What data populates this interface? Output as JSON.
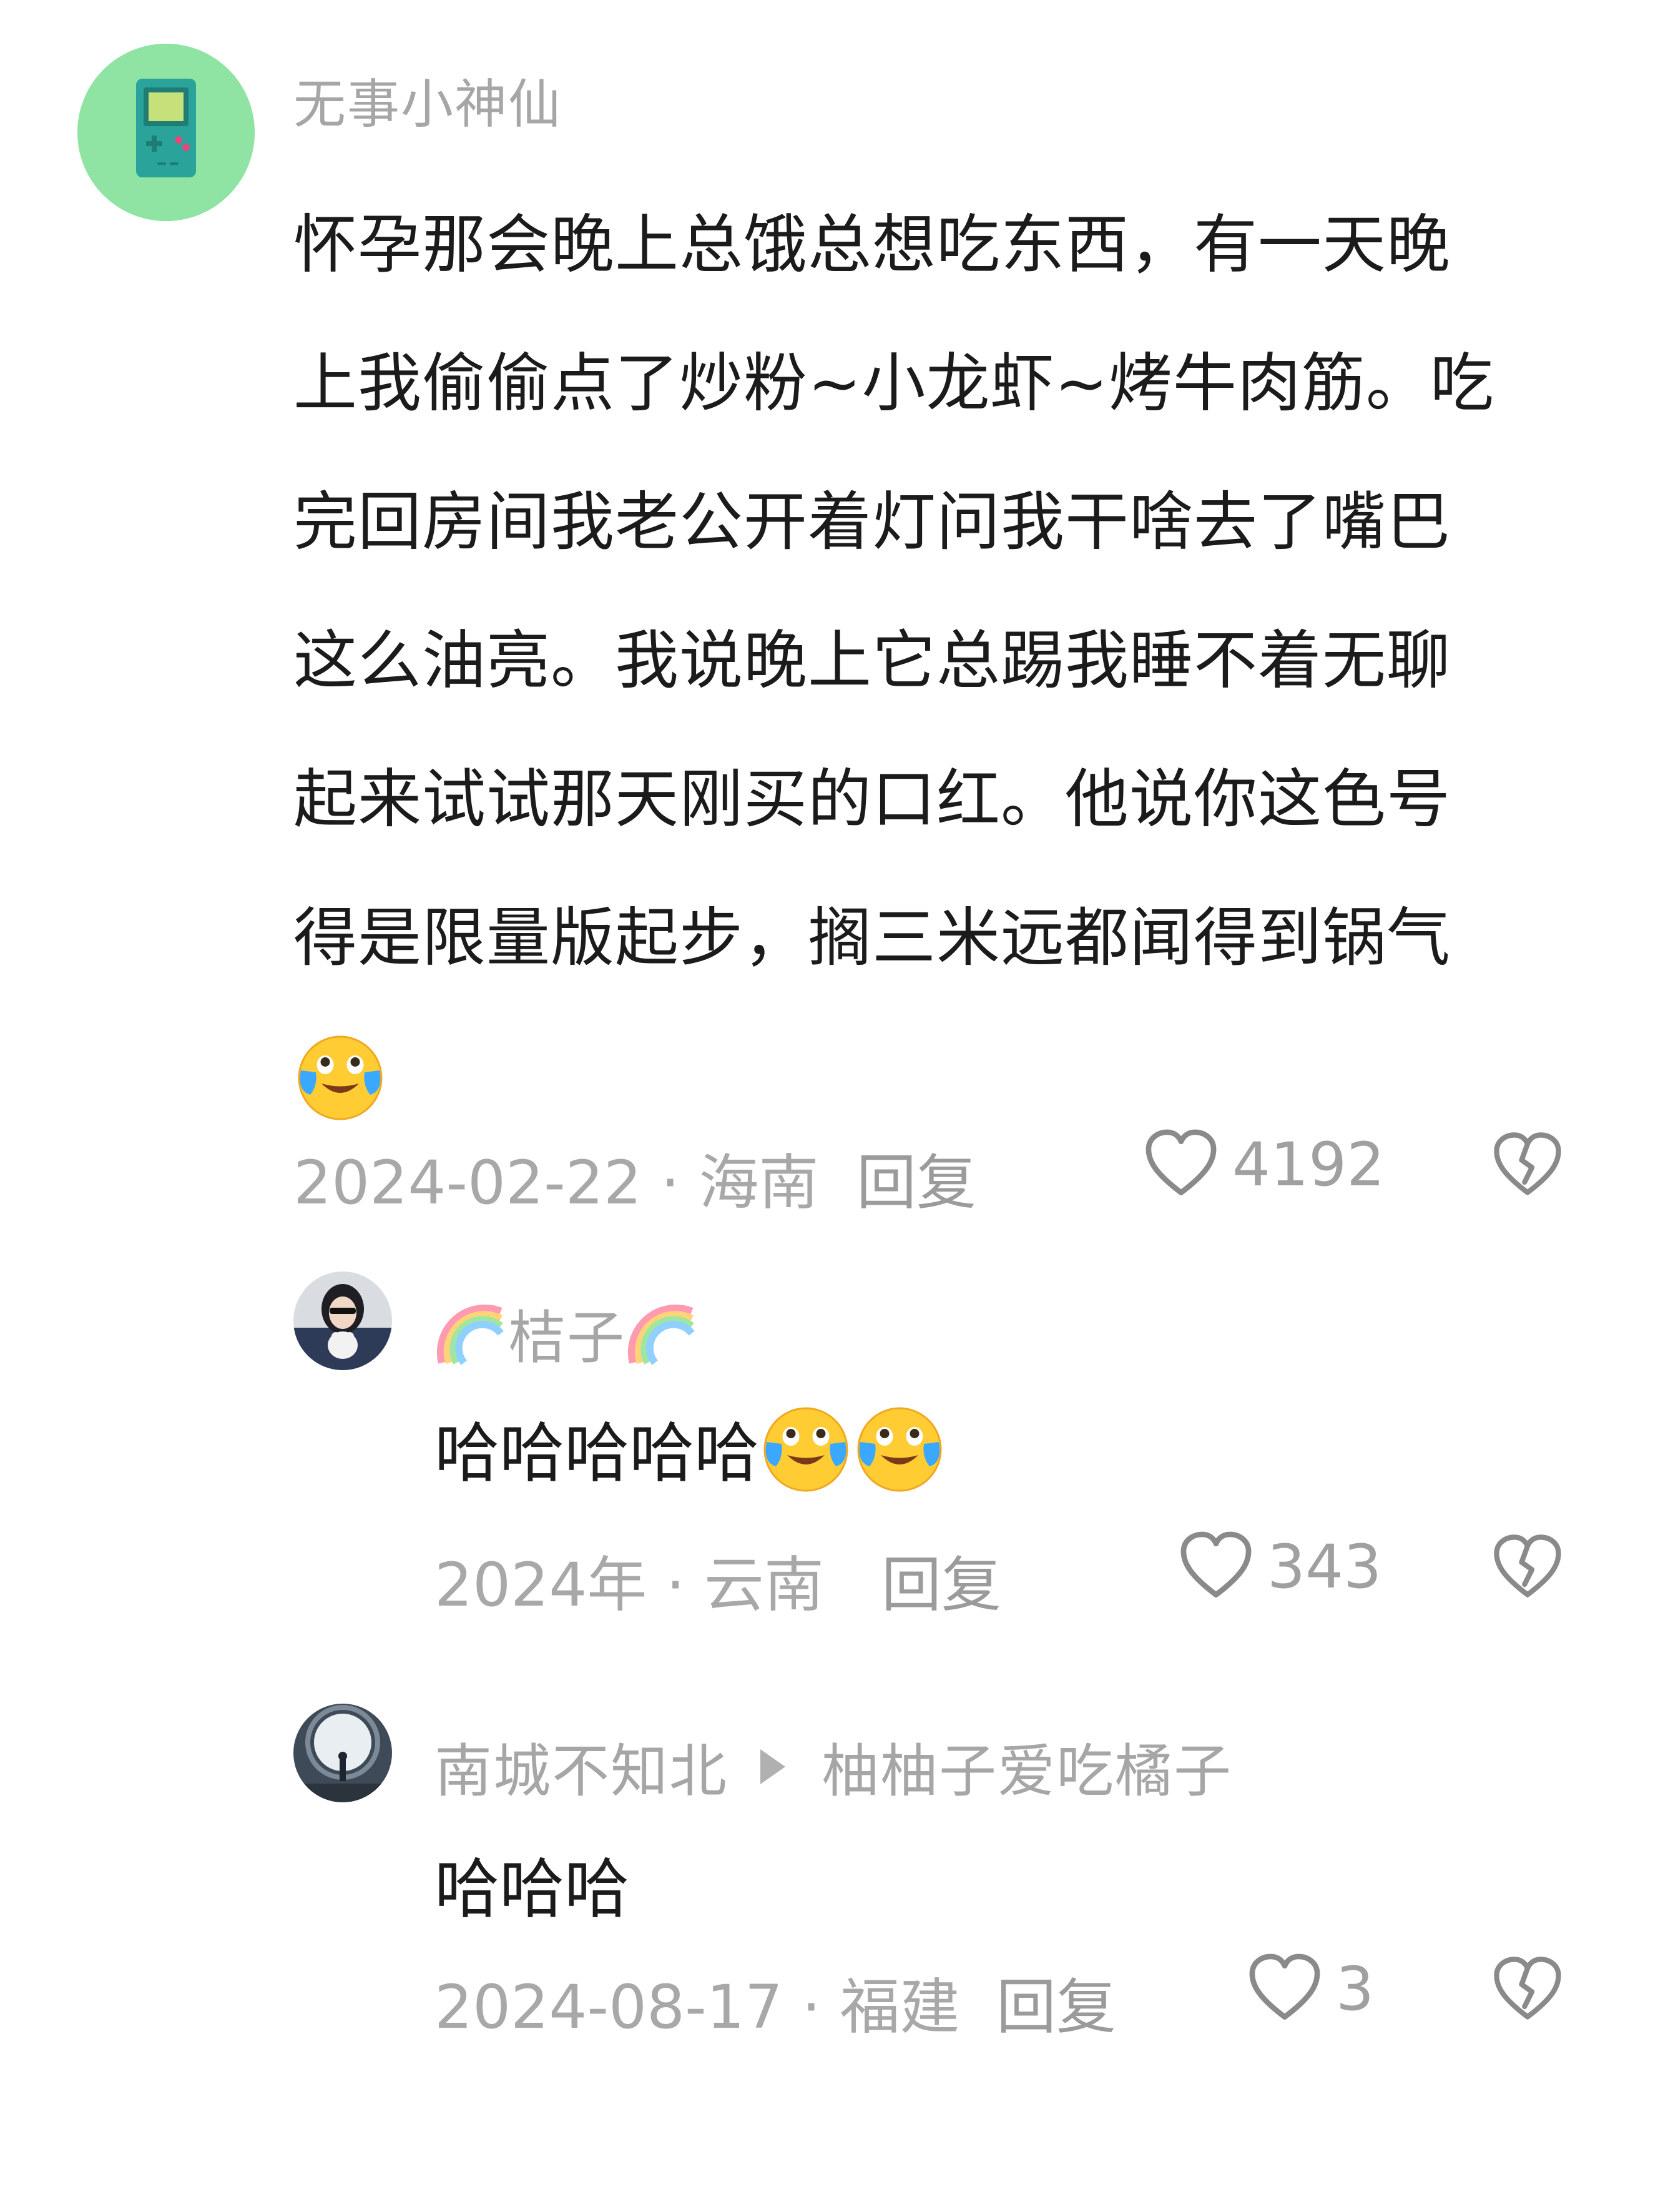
{
  "comment": {
    "username": "无事小神仙",
    "lines": [
      "怀孕那会晚上总饿总想吃东西，有一天晚",
      "上我偷偷点了炒粉~小龙虾~烤牛肉筋。吃",
      "完回房间我老公开着灯问我干啥去了嘴巴",
      "这么油亮。我说晚上它总踢我睡不着无聊",
      "起来试试那天刚买的口红。他说你这色号",
      "得是限量版起步，搁三米远都闻得到锅气"
    ],
    "emoji": "crying-laughing-emoji",
    "date": "2024-02-22",
    "location": "海南",
    "reply_label": "回复",
    "likes": "4192"
  },
  "replies": [
    {
      "username": "桔子",
      "username_decoration": "rainbow-emoji",
      "text": "哈哈哈哈哈",
      "emojis": [
        "crying-laughing-emoji",
        "crying-laughing-emoji"
      ],
      "date": "2024年",
      "location": "云南",
      "reply_label": "回复",
      "likes": "343"
    },
    {
      "username": "南城不知北",
      "reply_to": "柚柚子爱吃橘子",
      "text": "哈哈哈",
      "date": "2024-08-17",
      "location": "福建",
      "reply_label": "回复",
      "likes": "3"
    }
  ],
  "separator": " · ",
  "colors": {
    "muted_text": "#a6a6a6",
    "body_text": "#1b1b1b",
    "avatar_bg": "#8fe3a3",
    "icon_stroke": "#8a8a8a"
  }
}
